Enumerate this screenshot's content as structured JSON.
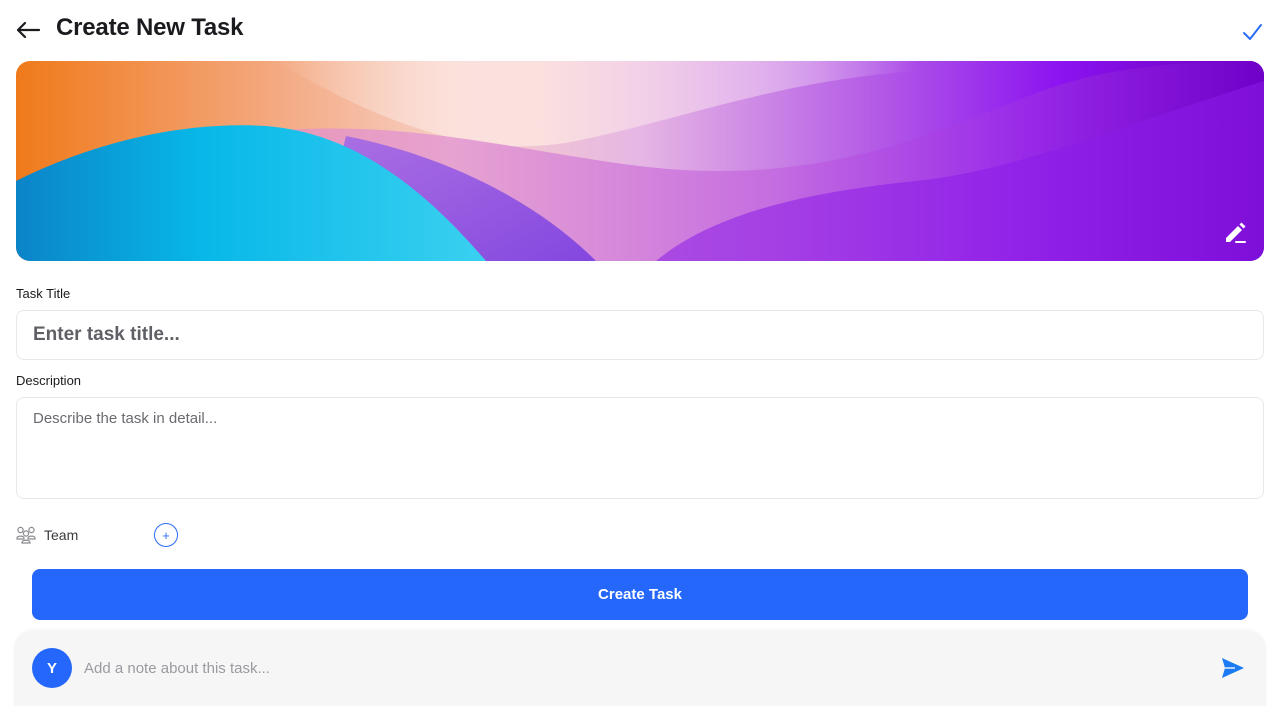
{
  "header": {
    "title": "Create New Task",
    "back_icon": "arrow-left-icon",
    "confirm_icon": "check-icon"
  },
  "cover": {
    "edit_icon": "pencil-icon"
  },
  "form": {
    "title_label": "Task Title",
    "title_placeholder": "Enter task title...",
    "title_value": "",
    "description_label": "Description",
    "description_placeholder": "Describe the task in detail...",
    "description_value": "",
    "team_label": "Team",
    "team_icon": "team-icon",
    "add_member_symbol": "+",
    "submit_label": "Create Task"
  },
  "note": {
    "avatar_initial": "Y",
    "placeholder": "Add a note about this task...",
    "value": "",
    "send_icon": "send-icon"
  },
  "colors": {
    "accent": "#2467fa",
    "title_text": "#1b1b1f",
    "input_border": "#e7e8ec",
    "note_bar_bg": "#f6f6f7"
  }
}
